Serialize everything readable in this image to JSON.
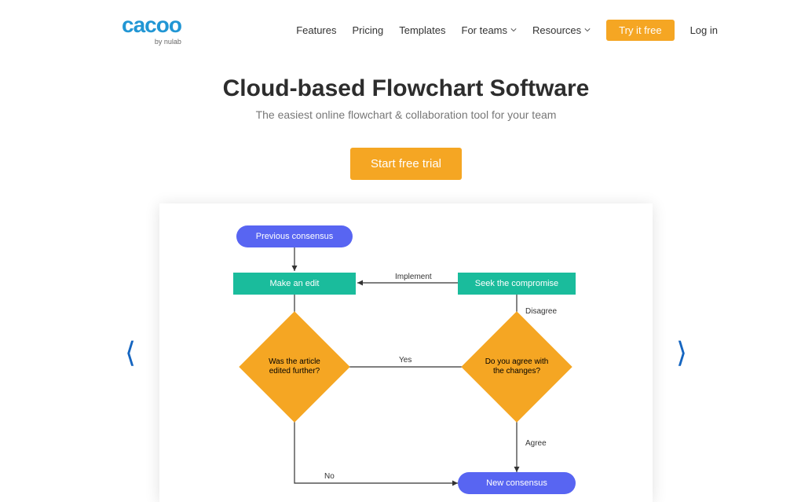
{
  "logo": {
    "main": "cacoo",
    "sub": "by nulab"
  },
  "nav": {
    "features": "Features",
    "pricing": "Pricing",
    "templates": "Templates",
    "forteams": "For teams",
    "resources": "Resources",
    "try": "Try it free",
    "login": "Log in"
  },
  "hero": {
    "title": "Cloud-based Flowchart Software",
    "subtitle": "The easiest online flowchart & collaboration tool for your team",
    "cta": "Start free trial"
  },
  "flow": {
    "previous": "Previous consensus",
    "edit": "Make an edit",
    "compromise": "Seek the compromise",
    "edited_q": "Was the article edited further?",
    "agree_q": "Do you agree with the changes?",
    "new": "New consensus",
    "implement": "Implement",
    "disagree": "Disagree",
    "yes": "Yes",
    "no": "No",
    "agree": "Agree"
  },
  "colors": {
    "accent": "#f5a623",
    "brand": "#2196d4",
    "pill": "#5865f2",
    "rect": "#1abc9c",
    "diamond": "#f5a623"
  }
}
